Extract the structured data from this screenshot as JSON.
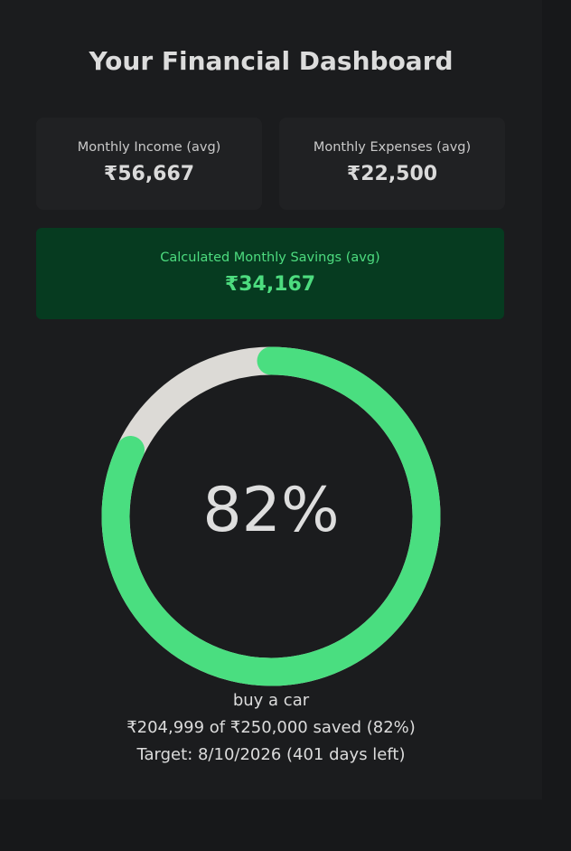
{
  "dashboard": {
    "title": "Your Financial Dashboard"
  },
  "income": {
    "label": "Monthly Income (avg)",
    "value": "₹56,667"
  },
  "expenses": {
    "label": "Monthly Expenses (avg)",
    "value": "₹22,500"
  },
  "savings": {
    "label": "Calculated Monthly Savings (avg)",
    "value": "₹34,167"
  },
  "goal": {
    "progress_fraction": 0.82,
    "progress_text": "82%",
    "name": "buy a car",
    "amount_line": "₹204,999 of ₹250,000 saved (82%)",
    "target_line": "Target: 8/10/2026 (401 days left)"
  },
  "colors": {
    "accent": "#4ade80",
    "track": "#dcdad6",
    "savings_bg": "#063b20",
    "background": "#1b1c1e"
  }
}
